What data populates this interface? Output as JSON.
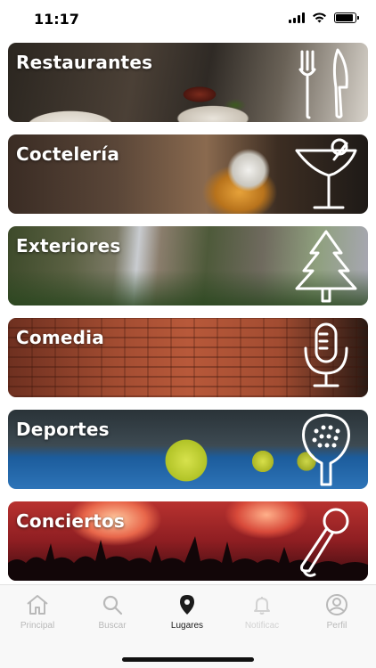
{
  "status": {
    "time": "11:17",
    "battery_level": 0.9
  },
  "categories": [
    {
      "title": "Restaurantes"
    },
    {
      "title": "Coctelería"
    },
    {
      "title": "Exteriores"
    },
    {
      "title": "Comedia"
    },
    {
      "title": "Deportes"
    },
    {
      "title": "Conciertos"
    }
  ],
  "tabbar": {
    "items": [
      {
        "label": "Principal",
        "icon": "home-icon",
        "active": false
      },
      {
        "label": "Buscar",
        "icon": "search-icon",
        "active": false
      },
      {
        "label": "Lugares",
        "icon": "location-pin-icon",
        "active": true
      },
      {
        "label": "Notificac",
        "icon": "bell-icon",
        "active": false
      },
      {
        "label": "Perfil",
        "icon": "profile-icon",
        "active": false
      }
    ]
  },
  "colors": {
    "tab_active": "#1b1b1b",
    "tab_inactive": "#b9b9b9",
    "tabbar_bg": "#f8f8f8"
  }
}
